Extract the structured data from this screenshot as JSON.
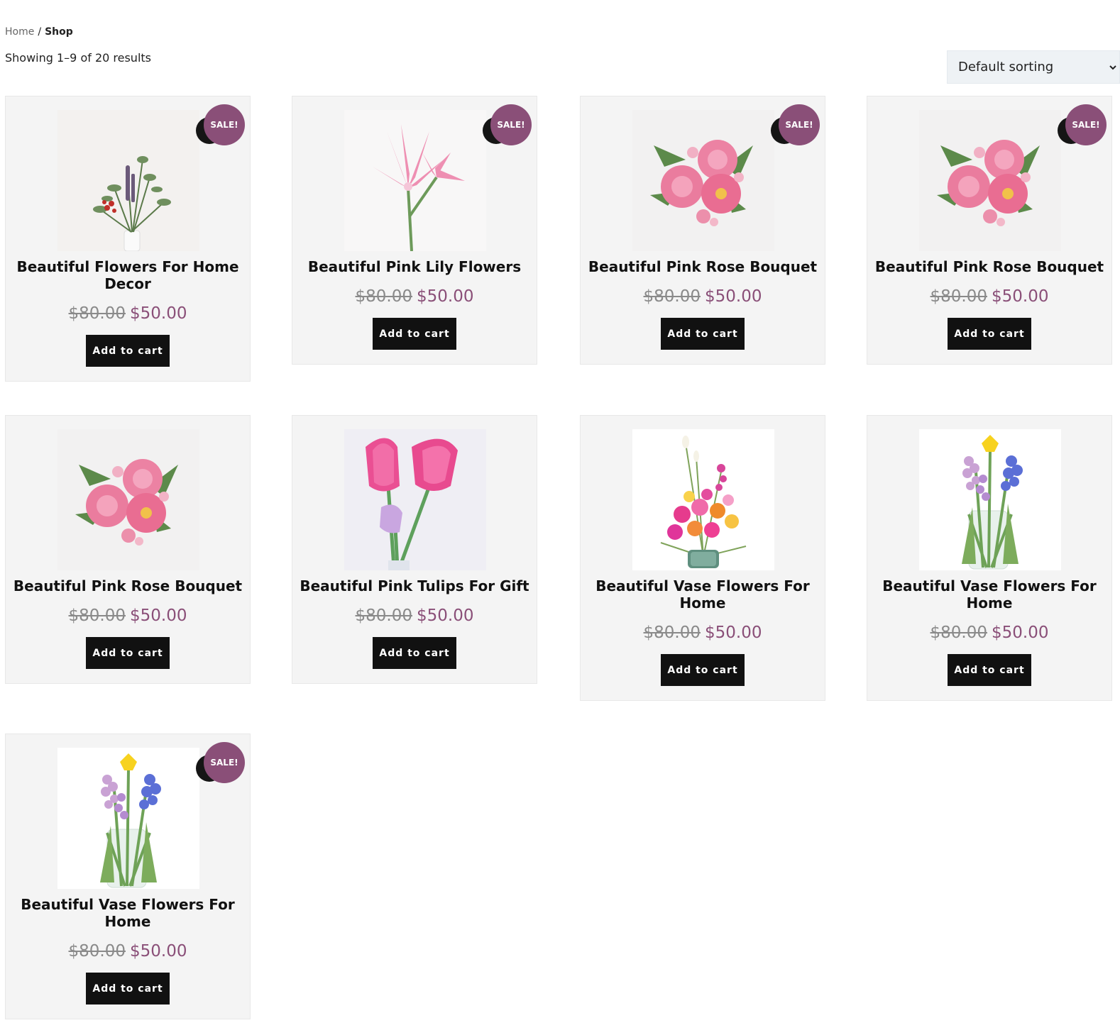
{
  "breadcrumb": {
    "home": "Home",
    "separator": "/",
    "current": "Shop"
  },
  "result_count": "Showing 1–9 of 20 results",
  "sorting": {
    "selected": "Default sorting",
    "icon": "chevron-down-icon"
  },
  "sale_label": "SALE!",
  "add_to_cart_label": "Add to cart",
  "colors": {
    "accent": "#8a4f78",
    "button": "#111111",
    "card_bg": "#f4f4f4",
    "old_price": "#8a8a8a"
  },
  "products": [
    {
      "title": "Beautiful Flowers For Home Decor",
      "old_price": "$80.00",
      "price": "$50.00",
      "sale": true,
      "image": "flowers-home-decor"
    },
    {
      "title": "Beautiful Pink Lily Flowers",
      "old_price": "$80.00",
      "price": "$50.00",
      "sale": true,
      "image": "pink-lily"
    },
    {
      "title": "Beautiful Pink Rose Bouquet",
      "old_price": "$80.00",
      "price": "$50.00",
      "sale": true,
      "image": "pink-rose-bouquet"
    },
    {
      "title": "Beautiful Pink Rose Bouquet",
      "old_price": "$80.00",
      "price": "$50.00",
      "sale": true,
      "image": "pink-rose-bouquet"
    },
    {
      "title": "Beautiful Pink Rose Bouquet",
      "old_price": "$80.00",
      "price": "$50.00",
      "sale": false,
      "image": "pink-rose-bouquet"
    },
    {
      "title": "Beautiful Pink Tulips For Gift",
      "old_price": "$80.00",
      "price": "$50.00",
      "sale": false,
      "image": "pink-tulips"
    },
    {
      "title": "Beautiful Vase Flowers For Home",
      "old_price": "$80.00",
      "price": "$50.00",
      "sale": false,
      "image": "vase-mixed-bouquet"
    },
    {
      "title": "Beautiful Vase Flowers For Home",
      "old_price": "$80.00",
      "price": "$50.00",
      "sale": false,
      "image": "vase-hyacinth"
    },
    {
      "title": "Beautiful Vase Flowers For Home",
      "old_price": "$80.00",
      "price": "$50.00",
      "sale": true,
      "image": "vase-hyacinth"
    }
  ]
}
